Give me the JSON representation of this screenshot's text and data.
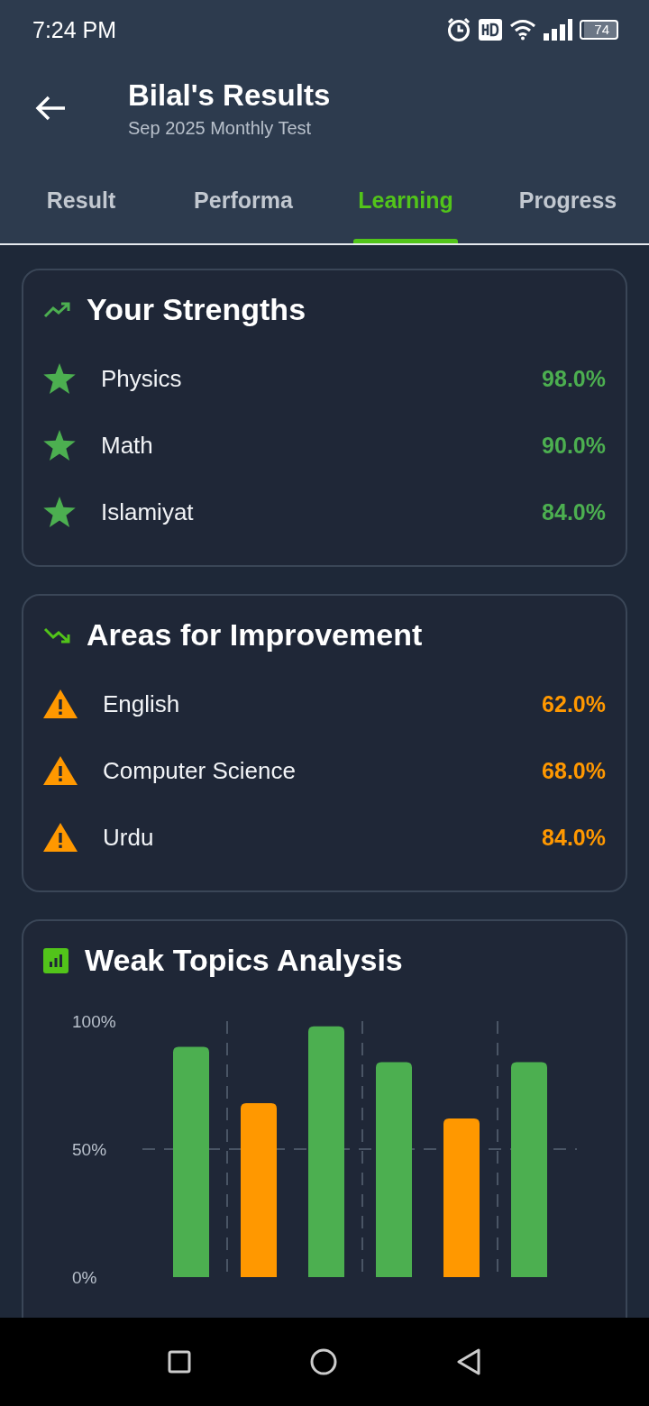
{
  "status_bar": {
    "time": "7:24 PM",
    "battery": "74"
  },
  "header": {
    "title": "Bilal's Results",
    "subtitle": "Sep 2025 Monthly Test"
  },
  "tabs": [
    {
      "label": "Result",
      "selected": false
    },
    {
      "label": "Performa",
      "selected": false
    },
    {
      "label": "Learning",
      "selected": true
    },
    {
      "label": "Progress",
      "selected": false
    }
  ],
  "sections": [
    {
      "kind": "strengths",
      "title": "Your Strengths",
      "items": [
        {
          "subject": "Physics",
          "score": "98.0%"
        },
        {
          "subject": "Math",
          "score": "90.0%"
        },
        {
          "subject": "Islamiyat",
          "score": "84.0%"
        }
      ]
    },
    {
      "kind": "improvement",
      "title": "Areas for Improvement",
      "items": [
        {
          "subject": "English",
          "score": "62.0%"
        },
        {
          "subject": "Computer Science",
          "score": "68.0%"
        },
        {
          "subject": "Urdu",
          "score": "84.0%"
        }
      ]
    }
  ],
  "weak_topics": {
    "title": "Weak Topics Analysis",
    "chart_data": {
      "type": "bar",
      "ylim": [
        0,
        100
      ],
      "yticks": [
        {
          "value": 0,
          "label": "0%"
        },
        {
          "value": 50,
          "label": "50%"
        },
        {
          "value": 100,
          "label": "100%"
        }
      ],
      "series": [
        {
          "color": "#4caf50",
          "values": [
            90,
            null,
            98,
            84,
            null,
            84
          ]
        },
        {
          "color": "#ff9800",
          "values": [
            null,
            68,
            null,
            null,
            62,
            null
          ]
        }
      ]
    }
  }
}
